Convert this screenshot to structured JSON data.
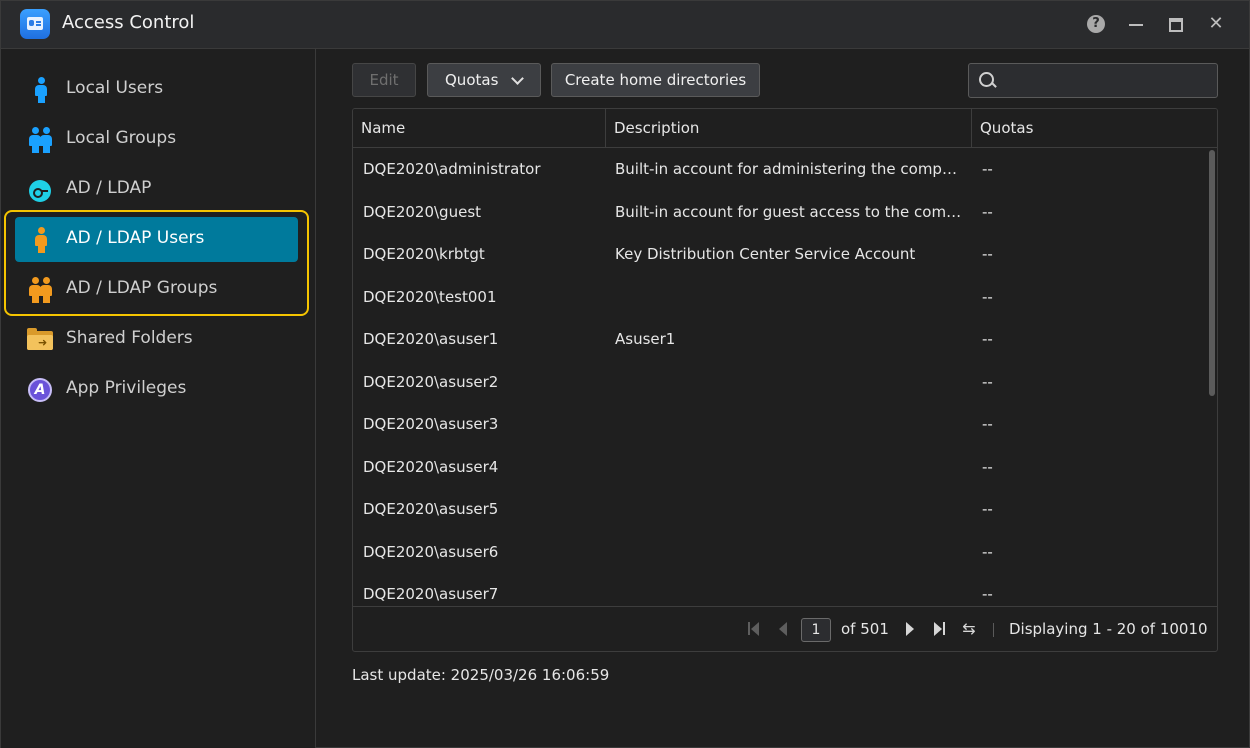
{
  "window": {
    "title": "Access Control"
  },
  "sidebar": {
    "items": [
      {
        "label": "Local Users",
        "icon": "user-icon"
      },
      {
        "label": "Local Groups",
        "icon": "group-icon"
      },
      {
        "label": "AD / LDAP",
        "icon": "key-icon"
      },
      {
        "label": "AD / LDAP Users",
        "icon": "user-icon",
        "active": true
      },
      {
        "label": "AD / LDAP Groups",
        "icon": "group-icon"
      },
      {
        "label": "Shared Folders",
        "icon": "folder-icon"
      },
      {
        "label": "App Privileges",
        "icon": "privileges-icon"
      }
    ]
  },
  "toolbar": {
    "edit_label": "Edit",
    "quotas_label": "Quotas",
    "home_dirs_label": "Create home directories",
    "search_value": ""
  },
  "table": {
    "columns": [
      "Name",
      "Description",
      "Quotas"
    ],
    "rows": [
      {
        "name": "DQE2020\\administrator",
        "description": "Built-in account for administering the computer/domain",
        "quota": "--"
      },
      {
        "name": "DQE2020\\guest",
        "description": "Built-in account for guest access to the computer/domain",
        "quota": "--"
      },
      {
        "name": "DQE2020\\krbtgt",
        "description": "Key Distribution Center Service Account",
        "quota": "--"
      },
      {
        "name": "DQE2020\\test001",
        "description": "",
        "quota": "--"
      },
      {
        "name": "DQE2020\\asuser1",
        "description": "Asuser1",
        "quota": "--"
      },
      {
        "name": "DQE2020\\asuser2",
        "description": "",
        "quota": "--"
      },
      {
        "name": "DQE2020\\asuser3",
        "description": "",
        "quota": "--"
      },
      {
        "name": "DQE2020\\asuser4",
        "description": "",
        "quota": "--"
      },
      {
        "name": "DQE2020\\asuser5",
        "description": "",
        "quota": "--"
      },
      {
        "name": "DQE2020\\asuser6",
        "description": "",
        "quota": "--"
      },
      {
        "name": "DQE2020\\asuser7",
        "description": "",
        "quota": "--"
      }
    ]
  },
  "pagination": {
    "current_page": "1",
    "of_pages": "of 501",
    "display_text": "Displaying 1 - 20 of 10010"
  },
  "status": {
    "last_update": "Last update: 2025/03/26 16:06:59"
  },
  "colors": {
    "active_bg": "#007a9c",
    "highlight": "#f5c400",
    "user_blue": "#1aa1ff",
    "user_orange": "#f29a1e"
  }
}
